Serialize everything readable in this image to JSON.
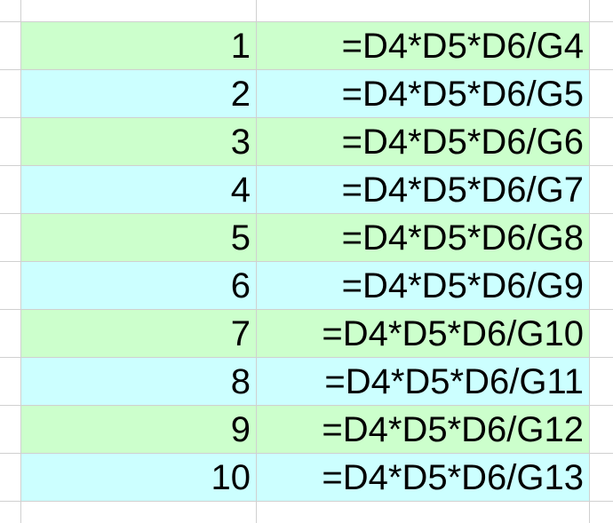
{
  "sheet": {
    "rows": [
      {
        "number": "1",
        "formula": "=D4*D5*D6/G4"
      },
      {
        "number": "2",
        "formula": "=D4*D5*D6/G5"
      },
      {
        "number": "3",
        "formula": "=D4*D5*D6/G6"
      },
      {
        "number": "4",
        "formula": "=D4*D5*D6/G7"
      },
      {
        "number": "5",
        "formula": "=D4*D5*D6/G8"
      },
      {
        "number": "6",
        "formula": "=D4*D5*D6/G9"
      },
      {
        "number": "7",
        "formula": "=D4*D5*D6/G10"
      },
      {
        "number": "8",
        "formula": "=D4*D5*D6/G11"
      },
      {
        "number": "9",
        "formula": "=D4*D5*D6/G12"
      },
      {
        "number": "10",
        "formula": "=D4*D5*D6/G13"
      }
    ],
    "colors": {
      "row_green": "#ccffcc",
      "row_cyan": "#ccffff",
      "grid": "#d0d0d0"
    }
  }
}
